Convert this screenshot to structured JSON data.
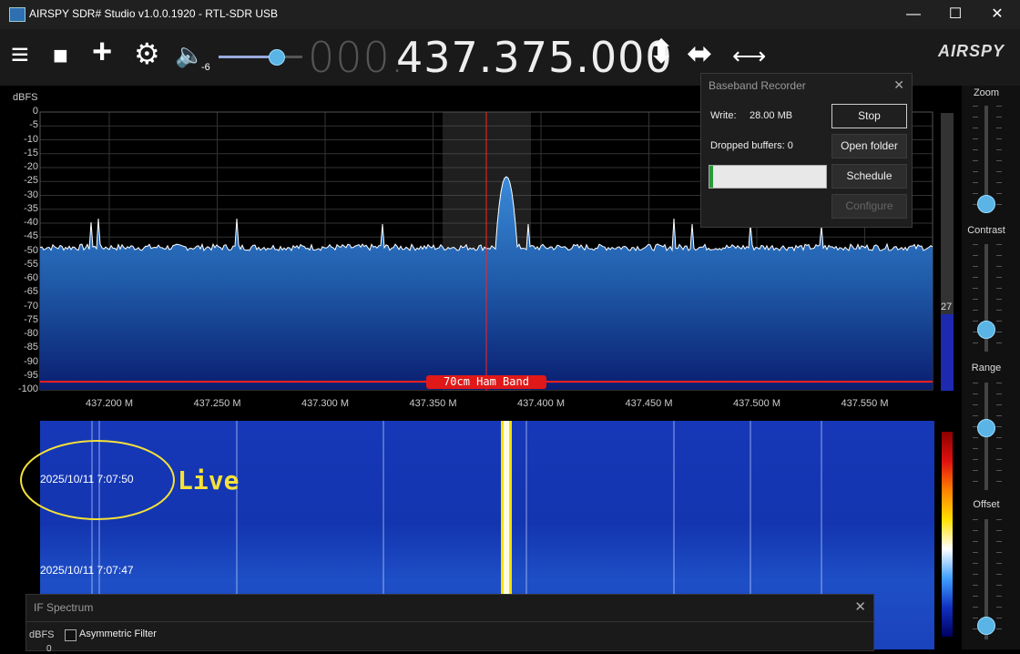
{
  "window": {
    "title": "AIRSPY SDR# Studio v1.0.0.1920 - RTL-SDR USB",
    "minimize": "—",
    "maximize": "☐",
    "close": "✕"
  },
  "toolbar": {
    "menu_icon": "≡",
    "stop_icon": "■",
    "add_icon": "+",
    "settings_icon": "⚙",
    "volume_icon": "🔈",
    "volume_level": "-6",
    "volume_fraction": 0.68,
    "freq_dim": "000.",
    "freq_main": "437.375.000",
    "updown_icon": "⬍",
    "leftright_icon": "⬌",
    "span_icon": "⟷",
    "brand": "AIRSPY"
  },
  "spectrum": {
    "unit_label": "dBFS",
    "y_ticks": [
      "0",
      "-5",
      "-10",
      "-15",
      "-20",
      "-25",
      "-30",
      "-35",
      "-40",
      "-45",
      "-50",
      "-55",
      "-60",
      "-65",
      "-70",
      "-75",
      "-80",
      "-85",
      "-90",
      "-95",
      "-100"
    ],
    "x_ticks": [
      "437.200 M",
      "437.250 M",
      "437.300 M",
      "437.350 M",
      "437.400 M",
      "437.450 M",
      "437.500 M",
      "437.550 M"
    ],
    "band_label": "70cm Ham Band",
    "level_value": "27",
    "accent": "#ff2020",
    "fill_color": "#2a6fc4"
  },
  "waterfall": {
    "timestamp_top": "2025/10/11 7:07:50",
    "timestamp_bottom": "2025/10/11 7:07:47",
    "annotation": "Live",
    "annotation_color": "#f5e13a"
  },
  "sidebar": {
    "zoom_label": "Zoom",
    "contrast_label": "Contrast",
    "range_label": "Range",
    "offset_label": "Offset"
  },
  "recorder": {
    "title": "Baseband Recorder",
    "close_icon": "✕",
    "write_label": "Write:",
    "write_value": "28.00 MB",
    "dropped_label": "Dropped buffers: 0",
    "stop_label": "Stop",
    "open_folder_label": "Open folder",
    "schedule_label": "Schedule",
    "configure_label": "Configure",
    "progress_fraction": 0.03
  },
  "if_spectrum": {
    "title": "IF Spectrum",
    "close_icon": "✕",
    "unit_label": "dBFS",
    "asymmetric_label": "Asymmetric Filter",
    "zero_label": "0"
  }
}
